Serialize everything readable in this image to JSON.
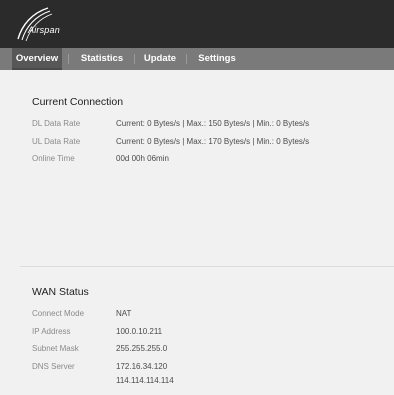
{
  "brand": {
    "name": "Airspan"
  },
  "nav": {
    "tabs": [
      {
        "label": "Overview"
      },
      {
        "label": "Statistics"
      },
      {
        "label": "Update"
      },
      {
        "label": "Settings"
      }
    ],
    "active": "Overview"
  },
  "current_connection": {
    "title": "Current Connection",
    "rows": [
      {
        "label": "DL Data Rate",
        "value": "Current: 0 Bytes/s | Max.: 150 Bytes/s | Min.: 0 Bytes/s"
      },
      {
        "label": "UL Data Rate",
        "value": "Current: 0 Bytes/s | Max.: 170 Bytes/s | Min.: 0 Bytes/s"
      },
      {
        "label": "Online Time",
        "value": "00d 00h 06min"
      }
    ]
  },
  "wan_status": {
    "title": "WAN Status",
    "rows": [
      {
        "label": "Connect Mode",
        "value": "NAT"
      },
      {
        "label": "IP Address",
        "value": "100.0.10.211"
      },
      {
        "label": "Subnet Mask",
        "value": "255.255.255.0"
      },
      {
        "label": "DNS Server",
        "value": "172.16.34.120",
        "value2": "114.114.114.114"
      }
    ]
  },
  "colors": {
    "header_bg": "#2b2b2b",
    "nav_bg": "#7a7a7a",
    "nav_active_bg": "#575757",
    "page_bg": "#f1f1f1"
  }
}
